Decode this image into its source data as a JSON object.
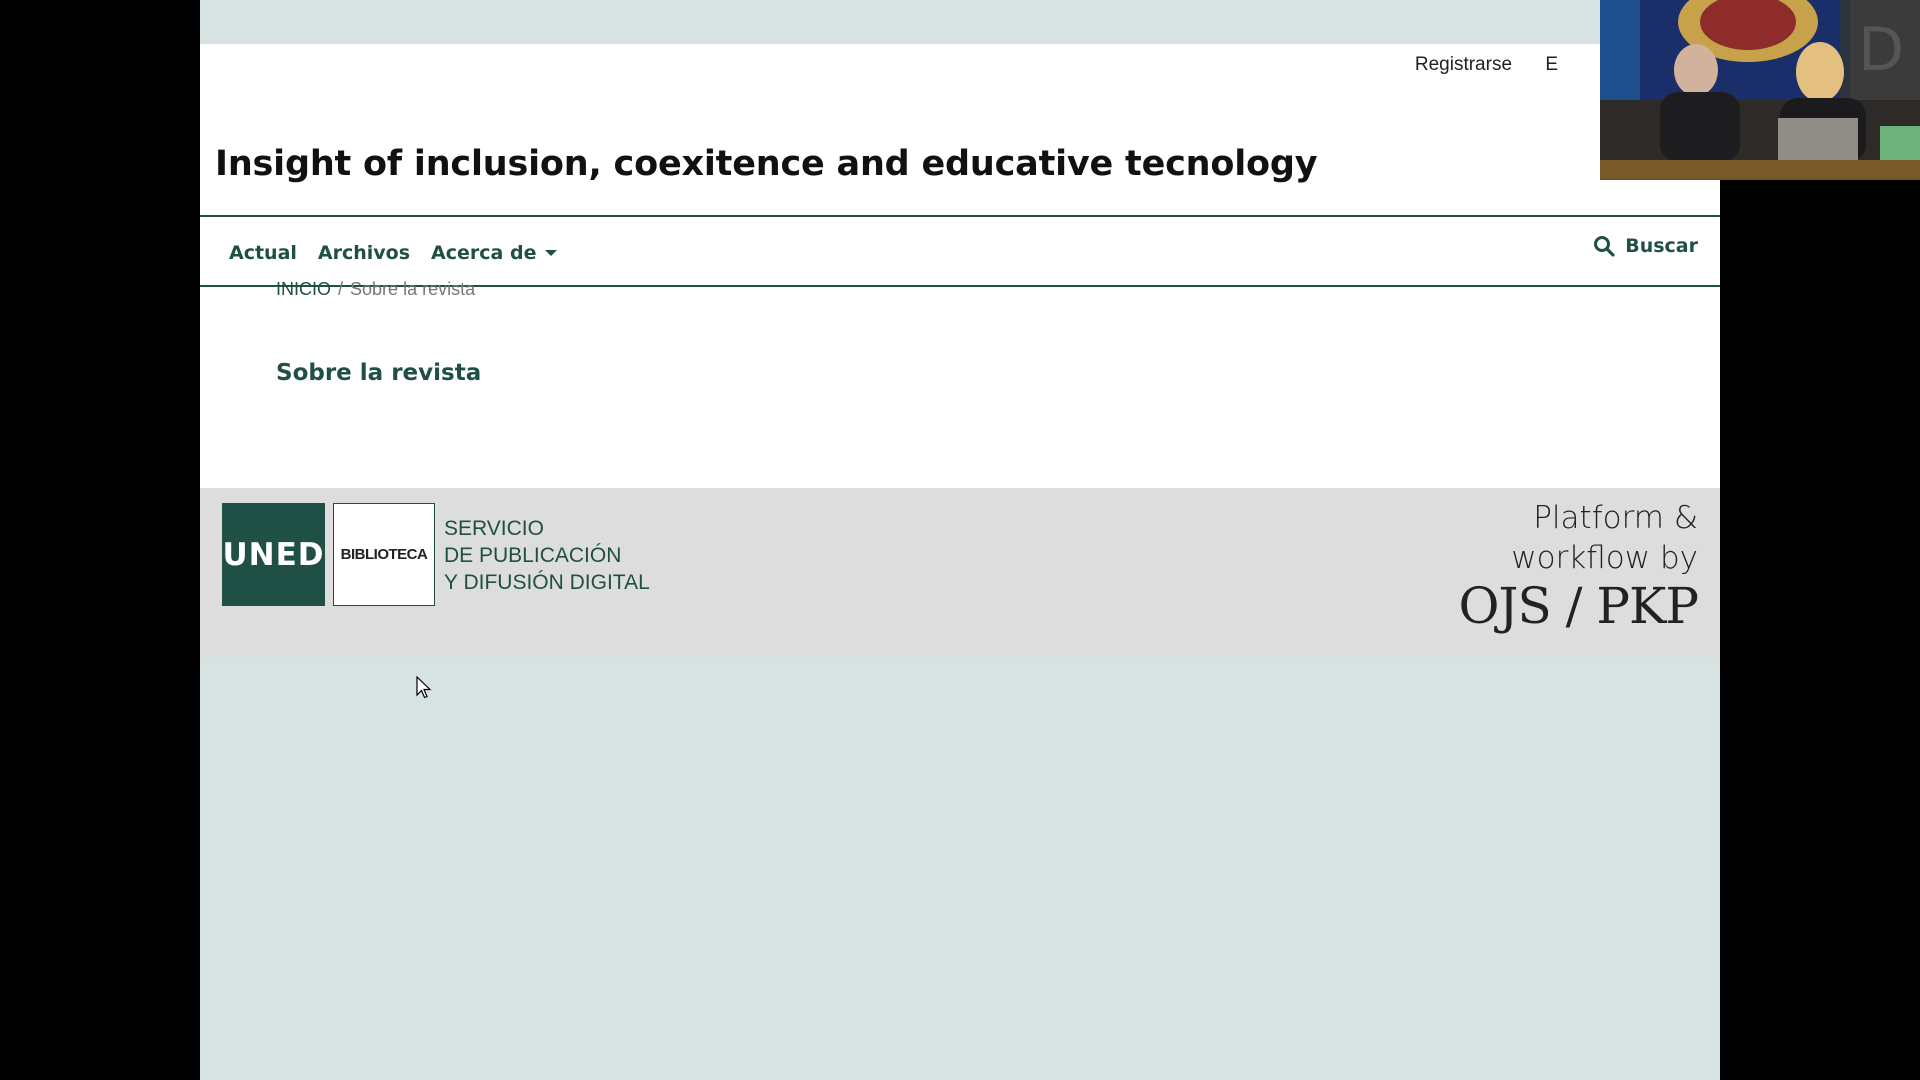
{
  "user_nav": {
    "register": "Registrarse",
    "login_partial": "E"
  },
  "journal": {
    "title": "Insight of inclusion, coexitence and educative tecnology"
  },
  "nav": {
    "items": [
      {
        "label": "Actual"
      },
      {
        "label": "Archivos"
      },
      {
        "label": "Acerca de"
      }
    ],
    "search_label": "Buscar"
  },
  "breadcrumb": {
    "home": "INICIO",
    "separator": "/",
    "current": "Sobre la revista"
  },
  "page": {
    "heading": "Sobre la revista"
  },
  "footer": {
    "uned_logo": "UNED",
    "biblioteca": "BIBLIOTECA",
    "service_lines": [
      "SERVICIO",
      "DE PUBLICACIÓN",
      "Y DIFUSIÓN DIGITAL"
    ],
    "pkp_line1": "Platform &",
    "pkp_line2": "workflow by",
    "pkp_line3": "OJS / PKP"
  },
  "colors": {
    "brand": "#1f4f45",
    "page_bg": "#d7e3e3",
    "footer_bg": "#dddddd"
  },
  "icons": {
    "search": "search-icon",
    "dropdown": "caret-down-icon",
    "cursor": "mouse-pointer-icon"
  }
}
